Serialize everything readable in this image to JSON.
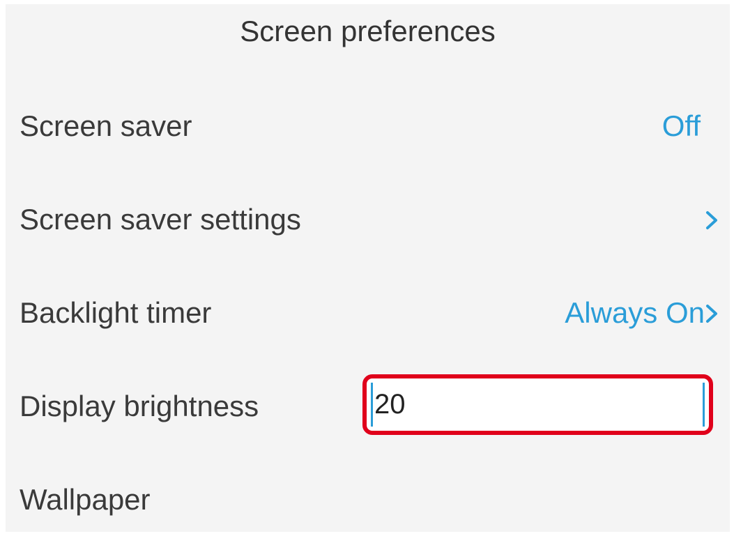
{
  "header": {
    "title": "Screen preferences"
  },
  "settings": [
    {
      "label": "Screen saver",
      "value": "Off",
      "icon": ""
    },
    {
      "label": "Screen saver settings",
      "value": "",
      "icon": "chevron-right-icon"
    },
    {
      "label": "Backlight timer",
      "value": "Always On",
      "icon": "chevron-right-icon"
    },
    {
      "label": "Display brightness",
      "input_value": "20"
    },
    {
      "label": "Wallpaper"
    }
  ],
  "colors": {
    "accent": "#2a9dd8",
    "highlight_border": "#e0001b",
    "background": "#f4f4f4",
    "text": "#3a3a3a"
  }
}
